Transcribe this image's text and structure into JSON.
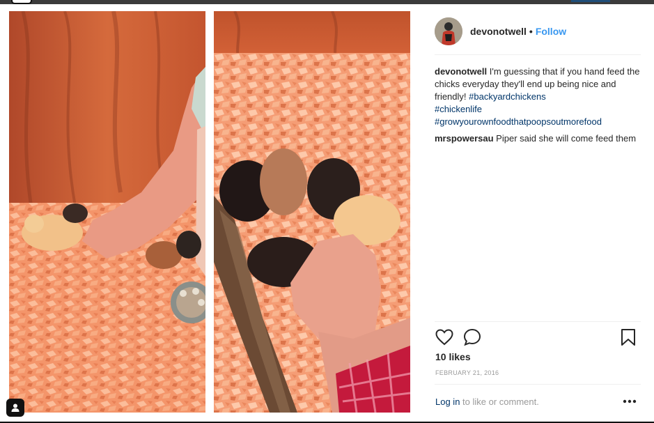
{
  "post": {
    "username": "devonotwell",
    "separator": "•",
    "follow_label": "Follow"
  },
  "caption": {
    "username": "devonotwell",
    "text": "I'm guessing that if you hand feed the chicks everyday they'll end up being nice and friendly! ",
    "hashtags": [
      "#backyardchickens",
      "#chickenlife",
      "#growyourownfoodthatpoopsoutmorefood"
    ]
  },
  "comments": [
    {
      "username": "mrspowersau",
      "text": "Piper said she will come feed them"
    }
  ],
  "likes_label": "10 likes",
  "date_label": "FEBRUARY 21, 2016",
  "login": {
    "link_label": "Log in",
    "suffix": " to like or comment."
  },
  "icons": {
    "like": "heart-icon",
    "comment": "comment-icon",
    "save": "bookmark-icon",
    "more": "more-options-icon",
    "user_tag": "user-tag-icon"
  },
  "colors": {
    "accent": "#3897f0",
    "hashtag": "#003569",
    "text": "#262626",
    "muted": "#999999"
  }
}
